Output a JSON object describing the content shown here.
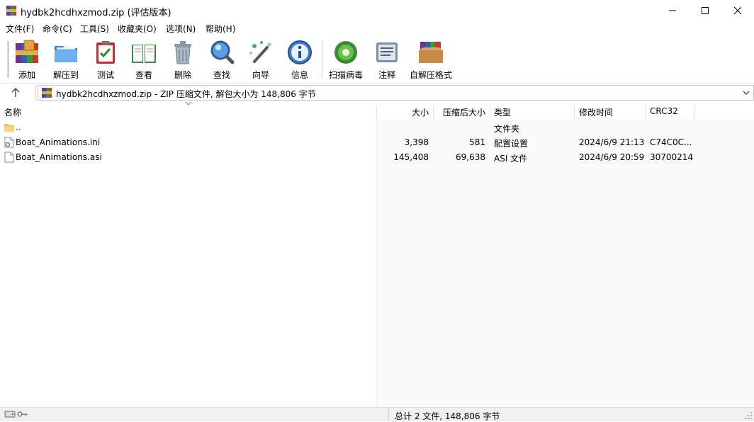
{
  "window": {
    "title": "hydbk2hcdhxzmod.zip (评估版本)",
    "app_icon": "winrar-icon",
    "controls": [
      "minimize-icon",
      "maximize-icon",
      "close-icon"
    ]
  },
  "menu": [
    {
      "label": "文件(F)"
    },
    {
      "label": "命令(C)"
    },
    {
      "label": "工具(S)"
    },
    {
      "label": "收藏夹(O)"
    },
    {
      "label": "选项(N)"
    },
    {
      "label": "帮助(H)"
    }
  ],
  "toolbar": [
    {
      "label": "添加",
      "icon": "add-archive-icon"
    },
    {
      "label": "解压到",
      "icon": "extract-folder-icon"
    },
    {
      "label": "测试",
      "icon": "test-clipboard-icon"
    },
    {
      "label": "查看",
      "icon": "view-book-icon"
    },
    {
      "label": "删除",
      "icon": "trash-icon"
    },
    {
      "label": "查找",
      "icon": "magnifier-icon"
    },
    {
      "label": "向导",
      "icon": "wizard-wand-icon"
    },
    {
      "label": "信息",
      "icon": "info-icon"
    },
    {
      "label": "扫描病毒",
      "icon": "virus-scan-icon"
    },
    {
      "label": "注释",
      "icon": "comment-icon"
    },
    {
      "label": "自解压格式",
      "icon": "sfx-box-icon"
    }
  ],
  "address": {
    "text": "hydbk2hcdhxzmod.zip - ZIP 压缩文件, 解包大小为 148,806 字节",
    "up_icon": "up-arrow-icon"
  },
  "columns": {
    "name": "名称",
    "size": "大小",
    "packed": "压缩后大小",
    "type": "类型",
    "modified": "修改时间",
    "crc": "CRC32"
  },
  "rows": [
    {
      "name": "..",
      "size": "",
      "packed": "",
      "type": "文件夹",
      "modified": "",
      "crc": "",
      "icon": "folder-icon"
    },
    {
      "name": "Boat_Animations.ini",
      "size": "3,398",
      "packed": "581",
      "type": "配置设置",
      "modified": "2024/6/9 21:13",
      "crc": "C74C0C...",
      "icon": "settings-file-icon"
    },
    {
      "name": "Boat_Animations.asi",
      "size": "145,408",
      "packed": "69,638",
      "type": "ASI 文件",
      "modified": "2024/6/9 20:59",
      "crc": "30700214",
      "icon": "file-icon"
    }
  ],
  "status": {
    "text": "总计 2 文件, 148,806 字节"
  }
}
